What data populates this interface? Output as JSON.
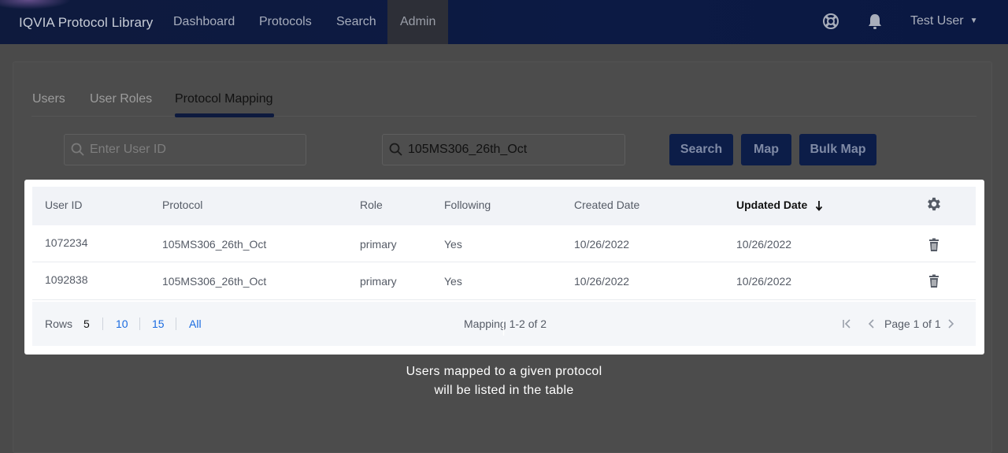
{
  "app": {
    "title": "IQVIA Protocol Library"
  },
  "nav": {
    "items": [
      {
        "label": "Dashboard"
      },
      {
        "label": "Protocols"
      },
      {
        "label": "Search"
      },
      {
        "label": "Admin"
      }
    ],
    "active": "Admin",
    "help_icon": "lifebuoy-icon",
    "notifications_icon": "bell-icon",
    "user": "Test User"
  },
  "tabs": [
    {
      "label": "Users"
    },
    {
      "label": "User Roles"
    },
    {
      "label": "Protocol Mapping"
    }
  ],
  "active_tab": "Protocol Mapping",
  "search": {
    "user_id_placeholder": "Enter User ID",
    "user_id_value": "",
    "protocol_value": "105MS306_26th_Oct",
    "search_label": "Search",
    "map_label": "Map",
    "bulk_map_label": "Bulk Map"
  },
  "table": {
    "columns": [
      "User ID",
      "Protocol",
      "Role",
      "Following",
      "Created Date",
      "Updated Date"
    ],
    "sorted_column": "Updated Date",
    "sort_direction": "descending",
    "settings_icon": "gear-icon",
    "rows": [
      {
        "user_id": "1072234",
        "protocol": "105MS306_26th_Oct",
        "role": "primary",
        "following": "Yes",
        "created": "10/26/2022",
        "updated": "10/26/2022"
      },
      {
        "user_id": "1092838",
        "protocol": "105MS306_26th_Oct",
        "role": "primary",
        "following": "Yes",
        "created": "10/26/2022",
        "updated": "10/26/2022"
      }
    ],
    "footer": {
      "rows_label": "Rows",
      "rows_options": [
        "5",
        "10",
        "15",
        "All"
      ],
      "rows_selected": "5",
      "count_text": "Mapping 1-2 of 2",
      "page_text": "Page 1 of 1"
    }
  },
  "tooltip": "Users mapped to a given protocol will be listed in the table",
  "colors": {
    "nav_bg": "#0e1a3d",
    "primary_button": "#0c1d48",
    "link": "#1a6be0",
    "overlay": "#4a4a4a"
  }
}
